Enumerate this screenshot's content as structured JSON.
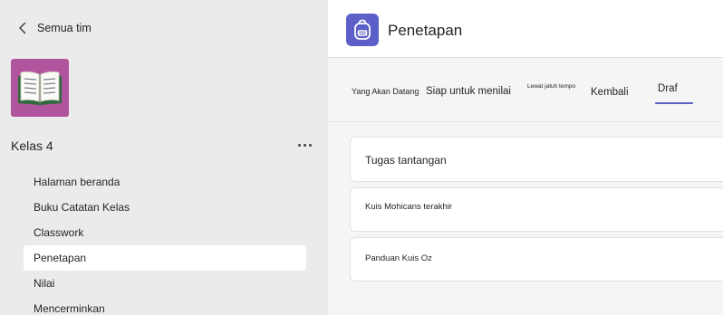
{
  "sidebar": {
    "back_label": "Semua tim",
    "class_icon": "open-book-icon",
    "class_name": "Kelas 4",
    "more_icon": "more-horizontal-icon",
    "nav_items": [
      {
        "label": "Halaman beranda"
      },
      {
        "label": "Buku Catatan Kelas"
      },
      {
        "label": "Classwork"
      },
      {
        "label": "Penetapan",
        "active": true
      },
      {
        "label": "Nilai"
      },
      {
        "label": "Mencerminkan"
      }
    ]
  },
  "main": {
    "header": {
      "title": "Penetapan",
      "icon": "backpack-icon"
    },
    "tabs": [
      {
        "label": "Yang Akan Datang"
      },
      {
        "label": "Siap untuk menilai"
      },
      {
        "label": "Lewat jatuh tempo"
      },
      {
        "label": "Kembali"
      },
      {
        "label": "Draf",
        "selected": true
      }
    ],
    "assignments": [
      {
        "title": "Tugas tantangan"
      },
      {
        "title": "Kuis Mohicans terakhir"
      },
      {
        "title": "Panduan Kuis Oz"
      }
    ]
  },
  "colors": {
    "accent": "#5b5fc7",
    "class_tile": "#b0549e",
    "sidebar_bg": "#ebebeb",
    "main_bg": "#f5f5f5"
  }
}
